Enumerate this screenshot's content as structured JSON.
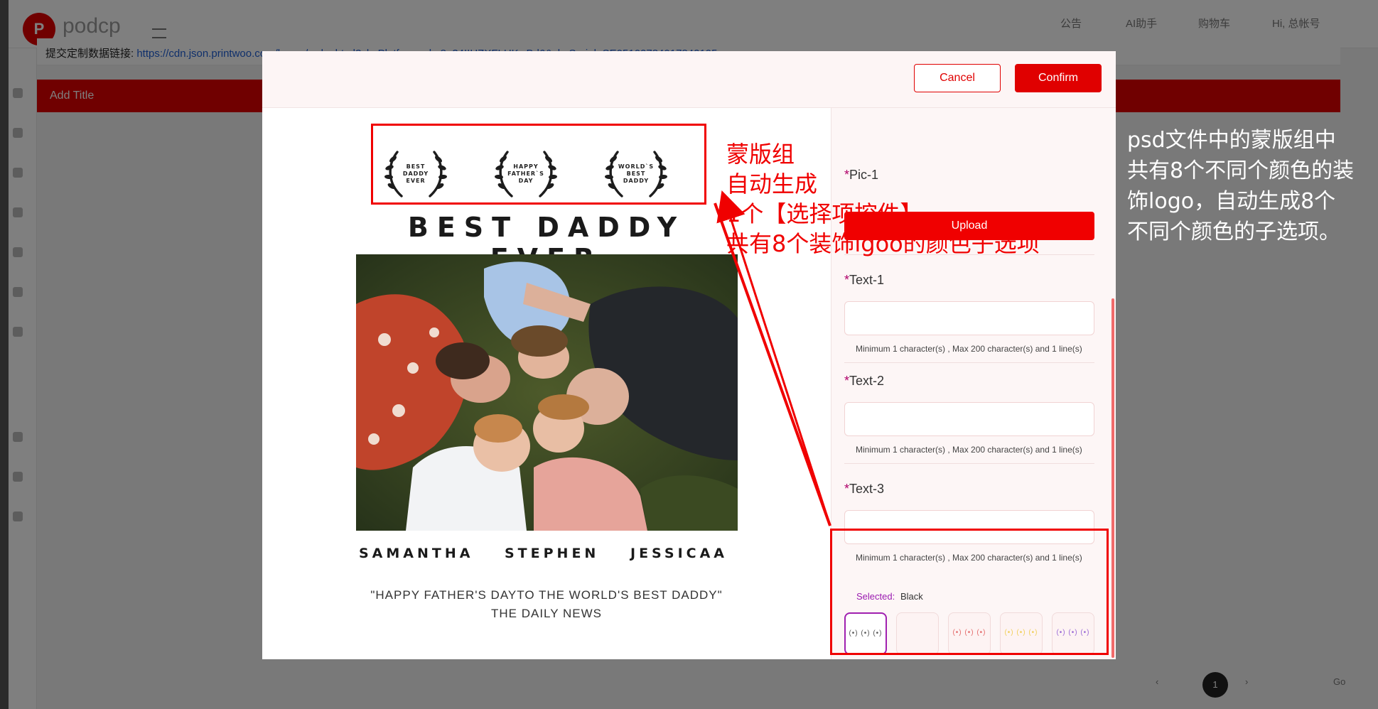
{
  "app": {
    "logo_letter": "P",
    "logo_text": "podcp",
    "nav": [
      "公告",
      "AI助手",
      "购物车",
      "Hi, 总帐号"
    ],
    "url_label": "提交定制数据链接:",
    "url_value": "https://cdn.json.printwoo.com/heron/order.html?skuPlatform=ybv8u34IIHZXFLHKwBd6&skuSerial=SE051027840178421​95",
    "red_bar_title": "Add Title",
    "pagination_prev": "‹",
    "pagination_current": "1",
    "pagination_next": "›",
    "pagination_go": "Go"
  },
  "modal": {
    "cancel_label": "Cancel",
    "confirm_label": "Confirm"
  },
  "preview": {
    "laurels": [
      {
        "text": "BEST DADDY EVER"
      },
      {
        "text": "HAPPY FATHER`S DAY"
      },
      {
        "text": "WORLD`S BEST DADDY"
      }
    ],
    "headline": "BEST DADDY EVER",
    "names": [
      "SAMANTHA",
      "STEPHEN",
      "JESSICAA"
    ],
    "quote": "\"HAPPY FATHER'S DAYTO THE WORLD'S BEST DADDY\"",
    "quote_sub": "THE DAILY NEWS"
  },
  "form": {
    "pic1_label": "Pic-1",
    "upload_label": "Upload",
    "text1_label": "Text-1",
    "text2_label": "Text-2",
    "text3_label": "Text-3",
    "hint": "Minimum 1 character(s) , Max 200 character(s) and 1 line(s)",
    "selected_label": "Selected:",
    "selected_value": "Black",
    "swatches": [
      {
        "color": "#555555",
        "selected": true
      },
      {
        "color": "#fdf3f3",
        "selected": false
      },
      {
        "color": "#e46b6b",
        "selected": false
      },
      {
        "color": "#f1cf5a",
        "selected": false
      },
      {
        "color": "#9a6ad6",
        "selected": false
      },
      {
        "color": "#f3c4c4",
        "selected": false
      },
      {
        "color": "#333333",
        "selected": false
      },
      {
        "color": "#7fd3d0",
        "selected": false
      }
    ]
  },
  "annotations": {
    "red_text": [
      "蒙版组",
      "自动生成",
      "1个【选择项控件】",
      "共有8个装饰lgoo的颜色子选项"
    ],
    "white_text": "psd文件中的蒙版组中共有8个不同个颜色的装饰logo，自动生成8个不同个颜色的子选项。"
  },
  "colors": {
    "accent": "#e00000",
    "selected_border": "#a020b0"
  }
}
